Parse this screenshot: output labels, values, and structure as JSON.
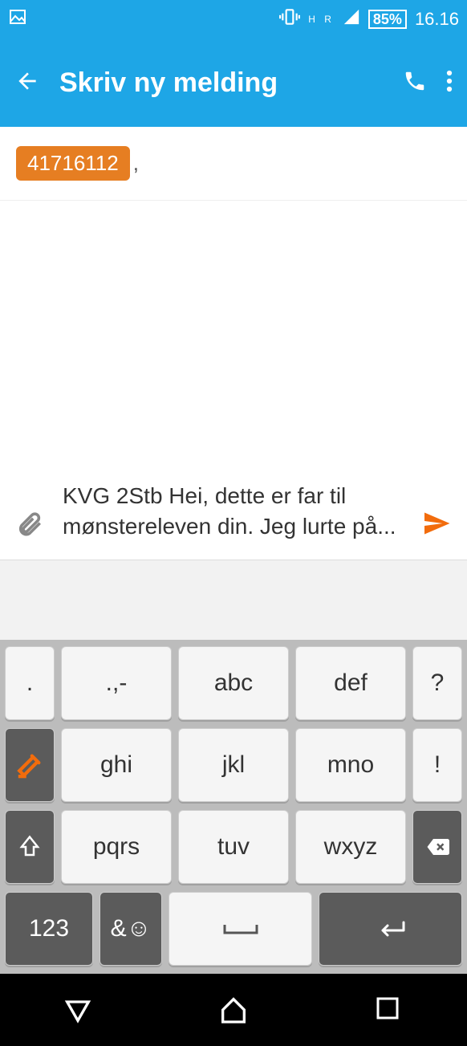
{
  "status": {
    "network_label": "H R",
    "battery": "85%",
    "time": "16.16"
  },
  "appbar": {
    "title": "Skriv ny melding"
  },
  "recipient": {
    "chip": "41716112",
    "after": ","
  },
  "compose": {
    "text": "KVG 2Stb Hei, dette er far til mønstereleven din. Jeg lurte på..."
  },
  "keyboard": {
    "row1": [
      ".",
      ".,-",
      "abc",
      "def",
      "?"
    ],
    "row2_edit": "",
    "row2": [
      "ghi",
      "jkl",
      "mno",
      "!"
    ],
    "row3": [
      "pqrs",
      "tuv",
      "wxyz"
    ],
    "row4_123": "123",
    "row4_sym": "&☺"
  }
}
